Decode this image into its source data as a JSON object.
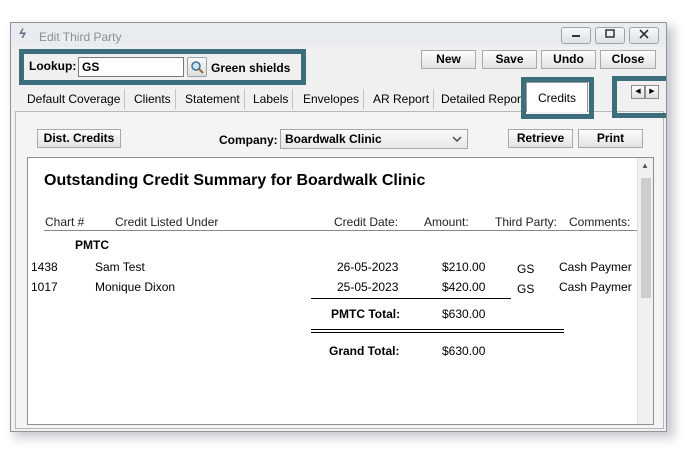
{
  "window": {
    "title": "Edit Third Party"
  },
  "lookup": {
    "label": "Lookup:",
    "value": "GS",
    "description": "Green shields"
  },
  "toolbar": {
    "new_label": "New",
    "save_label": "Save",
    "undo_label": "Undo",
    "close_label": "Close"
  },
  "tabs": [
    {
      "label": "Default Coverage"
    },
    {
      "label": "Clients"
    },
    {
      "label": "Statement"
    },
    {
      "label": "Labels"
    },
    {
      "label": "Envelopes"
    },
    {
      "label": "AR Report"
    },
    {
      "label": "Detailed Repor"
    },
    {
      "label": "Credits",
      "active": true
    }
  ],
  "credits": {
    "dist_credits_label": "Dist. Credits",
    "company_label": "Company:",
    "company_value": "Boardwalk Clinic",
    "retrieve_label": "Retrieve",
    "print_label": "Print"
  },
  "report": {
    "title": "Outstanding Credit Summary for Boardwalk Clinic",
    "columns": {
      "chart": "Chart #",
      "credit_listed_under": "Credit Listed Under",
      "credit_date": "Credit Date:",
      "amount": "Amount:",
      "third_party": "Third Party:",
      "comments": "Comments:"
    },
    "group": "PMTC",
    "rows": [
      {
        "chart": "1438",
        "name": "Sam Test",
        "date": "26-05-2023",
        "amount": "$210.00",
        "third_party": "GS",
        "comment": "Cash Paymer"
      },
      {
        "chart": "1017",
        "name": "Monique Dixon",
        "date": "25-05-2023",
        "amount": "$420.00",
        "third_party": "GS",
        "comment": "Cash Paymer"
      }
    ],
    "group_total_label": "PMTC Total:",
    "group_total": "$630.00",
    "grand_total_label": "Grand Total:",
    "grand_total": "$630.00"
  },
  "colors": {
    "highlight": "#3c6e7b"
  },
  "icons": {
    "app": "feather-icon",
    "lookup": "magnifier-icon",
    "minimize": "minimize-icon",
    "maximize": "maximize-icon",
    "close": "close-icon",
    "scroll_left": "arrow-left-icon",
    "scroll_right": "arrow-right-icon",
    "dropdown": "chevron-down-icon"
  }
}
